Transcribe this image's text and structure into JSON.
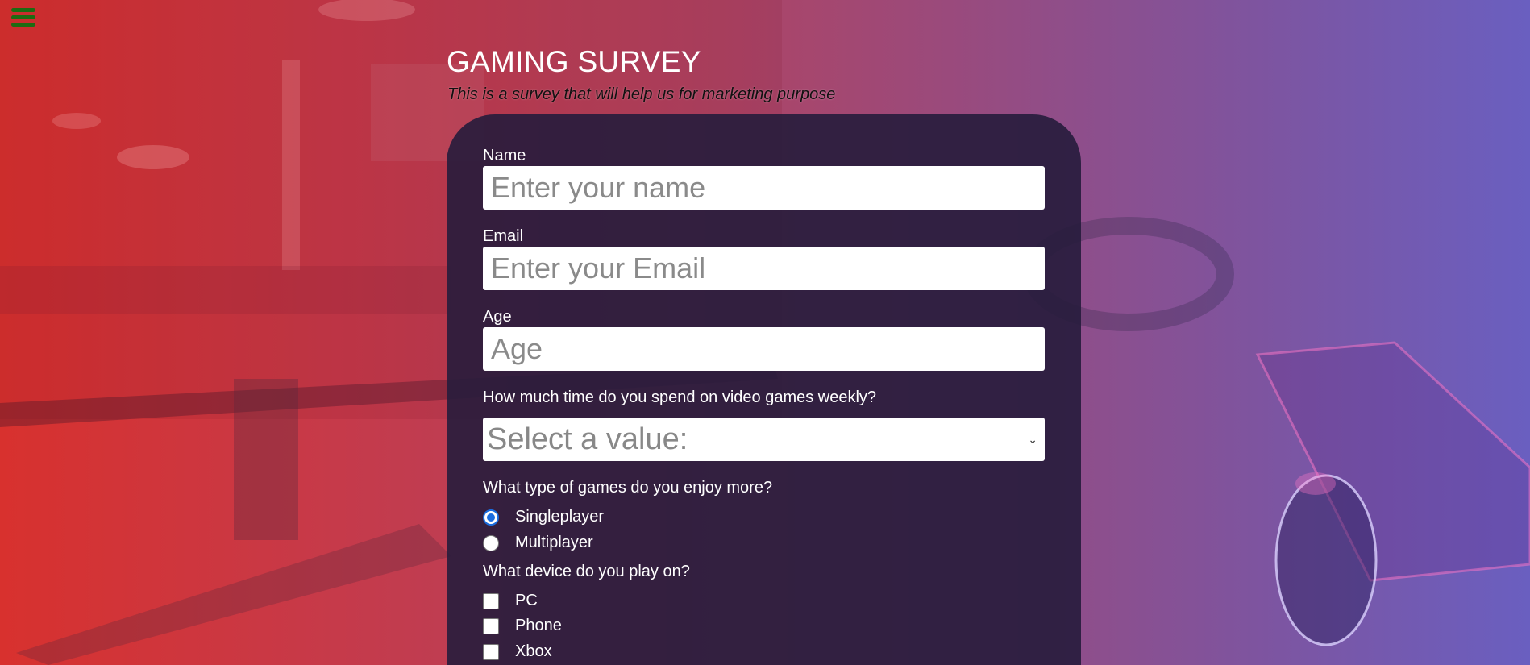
{
  "header": {
    "title": "GAMING SURVEY",
    "subtitle": "This is a survey that will help us for marketing purpose"
  },
  "menu": {
    "icon": "hamburger-menu-icon",
    "color": "#1e6b12"
  },
  "form": {
    "name": {
      "label": "Name",
      "placeholder": "Enter your name",
      "value": ""
    },
    "email": {
      "label": "Email",
      "placeholder": "Enter your Email",
      "value": ""
    },
    "age": {
      "label": "Age",
      "placeholder": "Age",
      "value": ""
    },
    "time_weekly": {
      "label": "How much time do you spend on video games weekly?",
      "selected": "Select a value:"
    },
    "game_type": {
      "label": "What type of games do you enjoy more?",
      "options": [
        {
          "label": "Singleplayer",
          "checked": true
        },
        {
          "label": "Multiplayer",
          "checked": false
        }
      ]
    },
    "device": {
      "label": "What device do you play on?",
      "options": [
        {
          "label": "PC",
          "checked": false
        },
        {
          "label": "Phone",
          "checked": false
        },
        {
          "label": "Xbox",
          "checked": false
        }
      ]
    }
  },
  "colors": {
    "panel": "#261c3c",
    "radio_accent": "#1a6de0",
    "background_left": "#d8312e",
    "background_right": "#6a5fc0"
  }
}
